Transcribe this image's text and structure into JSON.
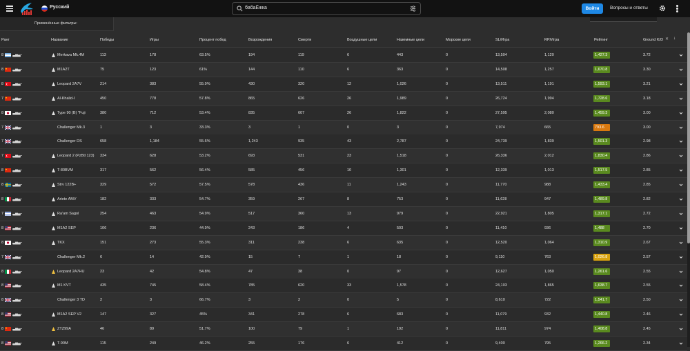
{
  "header": {
    "language": "Русский",
    "search_value": "бабаЁжка",
    "login_label": "Войти",
    "faq_label": "Вопросы и ответы"
  },
  "filters": {
    "applied_label": "Применённые фильтры:"
  },
  "table": {
    "columns": [
      "Ранг",
      "Название",
      "Победы",
      "Игры",
      "Процент побед",
      "Возрождения",
      "Смерти",
      "Воздушные цели",
      "Наземные цели",
      "Морские цели",
      "SL/Игра",
      "RP/Игра",
      "Рейтинг",
      "Ground K/D"
    ],
    "rows": [
      {
        "rank": "8",
        "nation": "argentina",
        "type": "tank",
        "name": "Merkava Mk.4M",
        "wins": "113",
        "games": "178",
        "winrate": "63.5%",
        "spawns": "194",
        "deaths": "119",
        "air": "6",
        "ground": "443",
        "naval": "0",
        "sl": "13,504",
        "rp": "1,120",
        "rating": "1,427.3",
        "rating_color": "#5a8a1f",
        "kd": "3.72"
      },
      {
        "rank": "8",
        "nation": "china",
        "type": "tank",
        "name": "M1A2T",
        "wins": "75",
        "games": "123",
        "winrate": "61%",
        "spawns": "144",
        "deaths": "110",
        "air": "6",
        "ground": "363",
        "naval": "0",
        "sl": "14,508",
        "rp": "1,257",
        "rating": "1,670.8",
        "rating_color": "#5a8a1f",
        "kd": "3.30"
      },
      {
        "rank": "8",
        "nation": "turkey",
        "type": "tank",
        "name": "Leopard 2A7V",
        "wins": "214",
        "games": "383",
        "winrate": "55.9%",
        "spawns": "430",
        "deaths": "320",
        "air": "12",
        "ground": "1,026",
        "naval": "0",
        "sl": "13,511",
        "rp": "1,191",
        "rating": "1,593.1",
        "rating_color": "#5a8a1f",
        "kd": "3.21"
      },
      {
        "rank": "7",
        "nation": "china",
        "type": "tank",
        "name": "Al-Khalid-I",
        "wins": "450",
        "games": "778",
        "winrate": "57.8%",
        "spawns": "865",
        "deaths": "626",
        "air": "26",
        "ground": "1,989",
        "naval": "0",
        "sl": "26,724",
        "rp": "1,994",
        "rating": "1,728.6",
        "rating_color": "#5a8a1f",
        "kd": "3.18"
      },
      {
        "rank": "8",
        "nation": "japan",
        "type": "tank",
        "name": "Type 90 (B) \"Fuji",
        "wins": "380",
        "games": "712",
        "winrate": "53.4%",
        "spawns": "835",
        "deaths": "607",
        "air": "26",
        "ground": "1,822",
        "naval": "0",
        "sl": "27,595",
        "rp": "2,080",
        "rating": "1,459.3",
        "rating_color": "#5a8a1f",
        "kd": "3.00"
      },
      {
        "rank": "7",
        "nation": "uk",
        "type": "",
        "name": "Challenger Mk.3",
        "wins": "1",
        "games": "3",
        "winrate": "33.3%",
        "spawns": "3",
        "deaths": "1",
        "air": "0",
        "ground": "3",
        "naval": "0",
        "sl": "7,974",
        "rp": "665",
        "rating": "793.6",
        "rating_color": "#d9790f",
        "kd": "3.00"
      },
      {
        "rank": "7",
        "nation": "uk",
        "type": "",
        "name": "Challenger DS",
        "wins": "658",
        "games": "1,184",
        "winrate": "55.6%",
        "spawns": "1,243",
        "deaths": "935",
        "air": "43",
        "ground": "2,787",
        "naval": "0",
        "sl": "24,739",
        "rp": "1,839",
        "rating": "1,501.3",
        "rating_color": "#5a8a1f",
        "kd": "2.98"
      },
      {
        "rank": "7",
        "nation": "turkey",
        "type": "tank",
        "name": "Leopard 2 (PzBtl 123)",
        "wins": "334",
        "games": "628",
        "winrate": "53.2%",
        "spawns": "693",
        "deaths": "531",
        "air": "23",
        "ground": "1,518",
        "naval": "0",
        "sl": "26,336",
        "rp": "2,012",
        "rating": "1,830.4",
        "rating_color": "#5a8a1f",
        "kd": "2.86"
      },
      {
        "rank": "8",
        "nation": "china",
        "type": "tank",
        "name": "T-80BVM",
        "wins": "317",
        "games": "562",
        "winrate": "56.4%",
        "spawns": "585",
        "deaths": "456",
        "air": "10",
        "ground": "1,301",
        "naval": "0",
        "sl": "12,339",
        "rp": "1,013",
        "rating": "1,517.5",
        "rating_color": "#5a8a1f",
        "kd": "2.85"
      },
      {
        "rank": "8",
        "nation": "sweden",
        "type": "tank",
        "name": "Strv 122B+",
        "wins": "329",
        "games": "572",
        "winrate": "57.5%",
        "spawns": "578",
        "deaths": "436",
        "air": "11",
        "ground": "1,243",
        "naval": "0",
        "sl": "11,770",
        "rp": "988",
        "rating": "1,433.4",
        "rating_color": "#5a8a1f",
        "kd": "2.85"
      },
      {
        "rank": "8",
        "nation": "italy",
        "type": "tank",
        "name": "Ariete AMV",
        "wins": "182",
        "games": "333",
        "winrate": "54.7%",
        "spawns": "359",
        "deaths": "267",
        "air": "8",
        "ground": "753",
        "naval": "0",
        "sl": "11,628",
        "rp": "947",
        "rating": "1,489.8",
        "rating_color": "#5a8a1f",
        "kd": "2.82"
      },
      {
        "rank": "7",
        "nation": "israel",
        "type": "tank",
        "name": "Ra'am Sagol",
        "wins": "254",
        "games": "463",
        "winrate": "54.9%",
        "spawns": "517",
        "deaths": "360",
        "air": "13",
        "ground": "979",
        "naval": "0",
        "sl": "22,921",
        "rp": "1,805",
        "rating": "1,317.1",
        "rating_color": "#5a8a1f",
        "kd": "2.72"
      },
      {
        "rank": "8",
        "nation": "usa",
        "type": "tank",
        "name": "M1A2 SEP",
        "wins": "106",
        "games": "236",
        "winrate": "44.9%",
        "spawns": "243",
        "deaths": "186",
        "air": "4",
        "ground": "503",
        "naval": "0",
        "sl": "11,410",
        "rp": "936",
        "rating": "1,488",
        "rating_color": "#5a8a1f",
        "kd": "2.70"
      },
      {
        "rank": "8",
        "nation": "japan",
        "type": "tank",
        "name": "TKX",
        "wins": "151",
        "games": "273",
        "winrate": "55.3%",
        "spawns": "311",
        "deaths": "238",
        "air": "6",
        "ground": "635",
        "naval": "0",
        "sl": "12,520",
        "rp": "1,064",
        "rating": "1,310.9",
        "rating_color": "#5a8a1f",
        "kd": "2.67"
      },
      {
        "rank": "7",
        "nation": "uk",
        "type": "",
        "name": "Challenger Mk.2",
        "wins": "6",
        "games": "14",
        "winrate": "42.9%",
        "spawns": "15",
        "deaths": "7",
        "air": "1",
        "ground": "18",
        "naval": "0",
        "sl": "9,110",
        "rp": "763",
        "rating": "1,026.8",
        "rating_color": "#d9a20f",
        "kd": "2.57"
      },
      {
        "rank": "8",
        "nation": "italy",
        "type": "premium",
        "name": "Leopard 2A7HU",
        "wins": "23",
        "games": "42",
        "winrate": "54.8%",
        "spawns": "47",
        "deaths": "38",
        "air": "0",
        "ground": "97",
        "naval": "0",
        "sl": "12,627",
        "rp": "1,050",
        "rating": "1,261.6",
        "rating_color": "#5a8a1f",
        "kd": "2.55"
      },
      {
        "rank": "8",
        "nation": "usa",
        "type": "tank",
        "name": "M1 KVT",
        "wins": "435",
        "games": "745",
        "winrate": "58.4%",
        "spawns": "785",
        "deaths": "620",
        "air": "33",
        "ground": "1,578",
        "naval": "0",
        "sl": "24,103",
        "rp": "1,865",
        "rating": "1,638.7",
        "rating_color": "#5a8a1f",
        "kd": "2.55"
      },
      {
        "rank": "8",
        "nation": "uk",
        "type": "",
        "name": "Challenger 3 TD",
        "wins": "2",
        "games": "3",
        "winrate": "66.7%",
        "spawns": "3",
        "deaths": "2",
        "air": "0",
        "ground": "5",
        "naval": "0",
        "sl": "8,610",
        "rp": "722",
        "rating": "1,541.7",
        "rating_color": "#5a8a1f",
        "kd": "2.50"
      },
      {
        "rank": "8",
        "nation": "usa",
        "type": "tank",
        "name": "M1A2 SEP V2",
        "wins": "147",
        "games": "327",
        "winrate": "45%",
        "spawns": "341",
        "deaths": "278",
        "air": "6",
        "ground": "683",
        "naval": "0",
        "sl": "11,079",
        "rp": "932",
        "rating": "1,440.8",
        "rating_color": "#5a8a1f",
        "kd": "2.46"
      },
      {
        "rank": "8",
        "nation": "china",
        "type": "premium",
        "name": "ZTZ99A",
        "wins": "46",
        "games": "89",
        "winrate": "51.7%",
        "spawns": "100",
        "deaths": "79",
        "air": "1",
        "ground": "192",
        "naval": "0",
        "sl": "11,811",
        "rp": "974",
        "rating": "1,408.8",
        "rating_color": "#5a8a1f",
        "kd": "2.45"
      },
      {
        "rank": "8",
        "nation": "usa",
        "type": "tank",
        "name": "T-90M",
        "wins": "115",
        "games": "249",
        "winrate": "46.2%",
        "spawns": "255",
        "deaths": "176",
        "air": "6",
        "ground": "412",
        "naval": "0",
        "sl": "9,400",
        "rp": "795",
        "rating": "1,266.2",
        "rating_color": "#5a8a1f",
        "kd": "2.34"
      }
    ]
  }
}
